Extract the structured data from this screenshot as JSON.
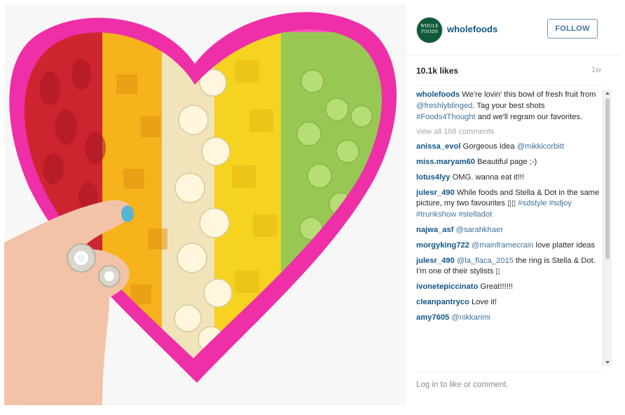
{
  "post": {
    "author": "wholefoods",
    "avatar_text": "WHOLE FOODS",
    "follow_label": "FOLLOW",
    "likes": "10.1k likes",
    "age": "1w",
    "view_all": "view all 168 comments",
    "login_text": "Log in to like or comment.",
    "caption": {
      "user": "wholefoods",
      "t1": " We're lovin' this bowl of fresh fruit from ",
      "m1": "@freshlyblinged",
      "t2": ". Tag your best shots ",
      "m2": "#Foods4Thought",
      "t3": " and we'll regram our favorites."
    }
  },
  "comments": [
    {
      "user": "anissa_evol",
      "text": " Gorgeous Idea ",
      "mention": "@mikkicorbitt",
      "after": ""
    },
    {
      "user": "miss.maryam60",
      "text": " Beautiful page ;-)",
      "mention": "",
      "after": ""
    },
    {
      "user": "lotus4lyy",
      "text": " OMG. wanna eat it!!!",
      "mention": "",
      "after": ""
    },
    {
      "user": "julesr_490",
      "text": " While foods and Stella & Dot in the same picture, my two favourites ▯▯ ",
      "mention": "#sdstyle #sdjoy #trunkshow #stelladot",
      "after": ""
    },
    {
      "user": "najwa_asf",
      "text": " ",
      "mention": "@sarahkhaer",
      "after": ""
    },
    {
      "user": "morgyking722",
      "text": " ",
      "mention": "@mainframecrain",
      "after": " love platter ideas"
    },
    {
      "user": "julesr_490",
      "text": " ",
      "mention": "@la_flaca_2015",
      "after": " the ring is Stella & Dot. I'm one of their stylists ▯"
    },
    {
      "user": "ivonetepiccinato",
      "text": " Great!!!!!!",
      "mention": "",
      "after": ""
    },
    {
      "user": "cleanpantryco",
      "text": " Love it!",
      "mention": "",
      "after": ""
    },
    {
      "user": "amy7605",
      "text": " ",
      "mention": "@nikkarimi",
      "after": ""
    }
  ],
  "colors": {
    "username": "#125688",
    "mention": "#3f729b",
    "heart_bowl": "#ee2fa7",
    "strawberry": "#d9232f",
    "mango": "#f6b51c",
    "banana": "#f3e8c4",
    "pineapple": "#f4d421",
    "grape": "#9ac955"
  }
}
